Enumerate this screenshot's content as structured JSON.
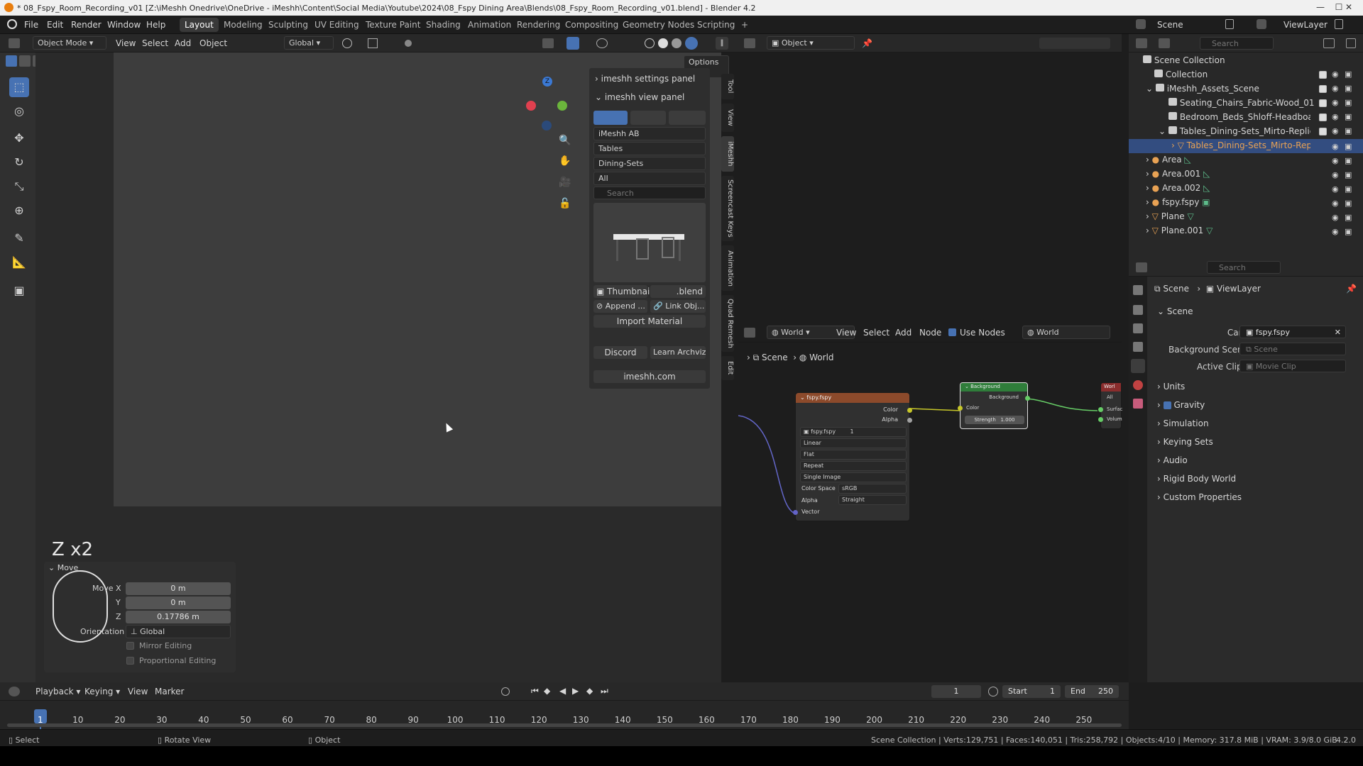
{
  "window": {
    "title": "* 08_Fspy_Room_Recording_v01 [Z:\\iMeshh Onedrive\\OneDrive - iMeshh\\Content\\Social Media\\Youtube\\2024\\08_Fspy Dining Area\\Blends\\08_Fspy_Room_Recording_v01.blend] - Blender 4.2",
    "min": "—",
    "max": "☐",
    "close": "✕"
  },
  "menus": [
    "File",
    "Edit",
    "Render",
    "Window",
    "Help"
  ],
  "workspaces": [
    "Layout",
    "Modeling",
    "Sculpting",
    "UV Editing",
    "Texture Paint",
    "Shading",
    "Animation",
    "Rendering",
    "Compositing",
    "Geometry Nodes",
    "Scripting",
    "+"
  ],
  "scene": {
    "name": "Scene",
    "viewlayer": "ViewLayer"
  },
  "viewport": {
    "mode": "Object Mode",
    "menu": [
      "View",
      "Select",
      "Add",
      "Object"
    ],
    "orientation": "Global",
    "options": "Options",
    "sidetabs": [
      "Tool",
      "View",
      "iMeshh",
      "Screencast Keys",
      "Animation",
      "Quad Remesh",
      "Edit"
    ]
  },
  "imeshh": {
    "settings_panel": "imeshh settings panel",
    "view_panel": "imeshh view panel",
    "library": "iMeshh AB",
    "category": "Tables",
    "subcategory": "Dining-Sets",
    "filter": "All",
    "search_placeholder": "Search",
    "thumbnail": "Thumbnail",
    "blend": ".blend",
    "append": "Append ...",
    "link": "Link Obj...",
    "import_material": "Import Material",
    "discord": "Discord",
    "learn": "Learn Archviz",
    "site": "imeshh.com"
  },
  "move_panel": {
    "hud": "Z x2",
    "title": "Move",
    "move_x_label": "Move X",
    "x": "0 m",
    "y_label": "Y",
    "y": "0 m",
    "z_label": "Z",
    "z": "0.17786 m",
    "orientation_label": "Orientation",
    "orientation": "Global",
    "mirror": "Mirror Editing",
    "proportional": "Proportional Editing"
  },
  "node_editor": {
    "type": "Object",
    "world_mode": "World",
    "menu": [
      "View",
      "Select",
      "Add",
      "Node"
    ],
    "use_nodes": "Use Nodes",
    "world": "World",
    "breadcrumb": [
      "Scene",
      "World"
    ],
    "image_node": {
      "title": "fspy.fspy",
      "out_color": "Color",
      "out_alpha": "Alpha",
      "image": "fspy.fspy",
      "users": "1",
      "interp": "Linear",
      "proj": "Flat",
      "ext": "Repeat",
      "source": "Single Image",
      "cs_label": "Color Space",
      "cs": "sRGB",
      "alpha_label": "Alpha",
      "alpha": "Straight",
      "in_vector": "Vector"
    },
    "bg_node": {
      "title": "Background",
      "out": "Background",
      "in_color": "Color",
      "strength_label": "Strength",
      "strength": "1.000"
    },
    "out_node": {
      "title": "Worl",
      "all": "All",
      "surface": "Surface",
      "volume": "Volume"
    }
  },
  "outliner": {
    "search_placeholder": "Search",
    "root": "Scene Collection",
    "items": [
      {
        "label": "Collection"
      },
      {
        "label": "iMeshh_Assets_Scene"
      },
      {
        "label": "Seating_Chairs_Fabric-Wood_01"
      },
      {
        "label": "Bedroom_Beds_Shloff-Headboard-C"
      },
      {
        "label": "Tables_Dining-Sets_Mirto-Replica_C"
      },
      {
        "label": "Tables_Dining-Sets_Mirto-Repli"
      },
      {
        "label": "Area"
      },
      {
        "label": "Area.001"
      },
      {
        "label": "Area.002"
      },
      {
        "label": "fspy.fspy"
      },
      {
        "label": "Plane"
      },
      {
        "label": "Plane.001"
      }
    ]
  },
  "properties": {
    "search_placeholder": "Search",
    "crumb_scene": "Scene",
    "crumb_vl": "ViewLayer",
    "section": "Scene",
    "camera_label": "Camera",
    "camera": "fspy.fspy",
    "bg_label": "Background Scene",
    "bg_ph": "Scene",
    "clip_label": "Active Clip",
    "clip_ph": "Movie Clip",
    "panels": [
      "Units",
      "Gravity",
      "Simulation",
      "Keying Sets",
      "Audio",
      "Rigid Body World",
      "Custom Properties"
    ]
  },
  "timeline": {
    "menu": [
      "Playback",
      "Keying",
      "View",
      "Marker"
    ],
    "frame": "1",
    "start_label": "Start",
    "start": "1",
    "end_label": "End",
    "end": "250",
    "ticks": [
      "1",
      "10",
      "20",
      "30",
      "40",
      "50",
      "60",
      "70",
      "80",
      "90",
      "100",
      "110",
      "120",
      "130",
      "140",
      "150",
      "160",
      "170",
      "180",
      "190",
      "200",
      "210",
      "220",
      "230",
      "240",
      "250"
    ]
  },
  "status": {
    "select": "Select",
    "rotate": "Rotate View",
    "object": "Object",
    "stats": "Scene Collection | Verts:129,751 | Faces:140,051 | Tris:258,792 | Objects:4/10 | Memory: 317.8 MiB | VRAM: 3.9/8.0 GiB",
    "version": "4.2.0"
  }
}
